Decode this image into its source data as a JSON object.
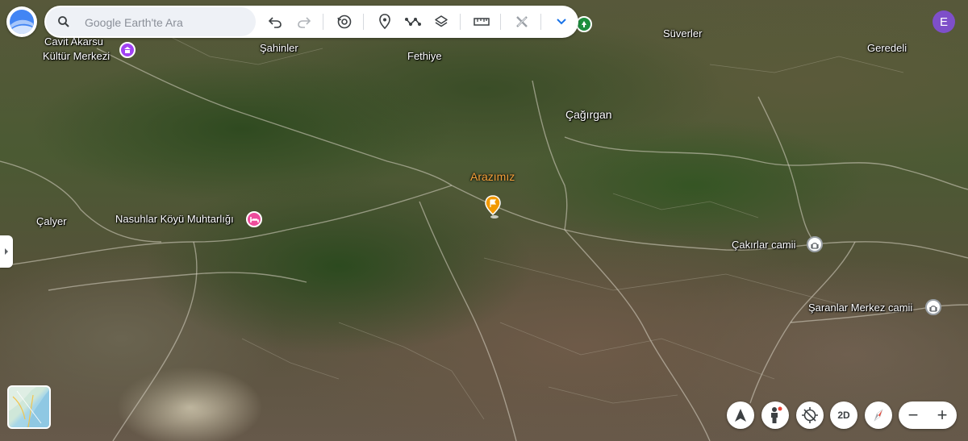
{
  "search": {
    "placeholder": "Google Earth'te Ara"
  },
  "user": {
    "avatar_initial": "E"
  },
  "map_labels": {
    "cavit_akarsu_line1": "Cavit Akarsu",
    "cavit_akarsu_line2": "Kültür Merkezi",
    "sahinler": "Şahinler",
    "fethiye": "Fethiye",
    "suverler": "Süverler",
    "geredeli": "Geredeli",
    "cagirgan": "Çağırgan",
    "arazimiz": "Arazımız",
    "calyer": "Çalyer",
    "nasuhlar": "Nasuhlar Köyü Muhtarlığı",
    "cakirlar_camii": "Çakırlar camii",
    "saranlar_camii": "Şaranlar Merkez camii"
  },
  "controls": {
    "two_d_label": "2D",
    "zoom_out": "−",
    "zoom_in": "+"
  },
  "colors": {
    "culture_poi": "#a142f4",
    "hotel_poi": "#ee4c9c",
    "park_poi": "#1e8e3e",
    "mosque_poi": "#ffffff",
    "placemark": "#f29900",
    "avatar": "#7e4fc9"
  },
  "icons": [
    "search-icon",
    "undo-icon",
    "redo-icon",
    "history-icon",
    "placemark-add-icon",
    "path-icon",
    "layers-icon",
    "ruler-icon",
    "tools-icon",
    "chevron-down-icon",
    "compass-north-icon",
    "street-view-icon",
    "location-icon",
    "compass-icon"
  ]
}
